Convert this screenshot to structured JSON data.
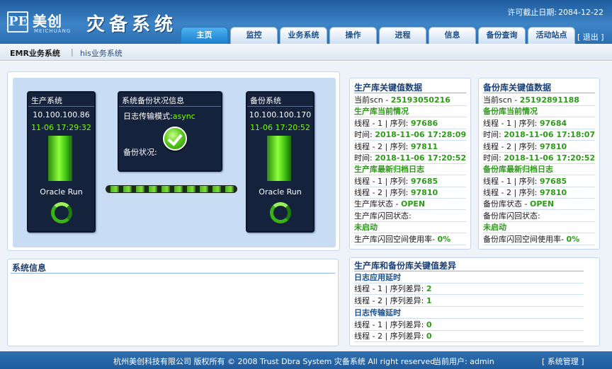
{
  "header": {
    "logo_mark": "PE",
    "logo_cn": "美创",
    "logo_en": "MEICHUANG",
    "app_title": "灾备系统",
    "license_label": "许可截止日期:",
    "license_date": "2084-12-22",
    "nav": [
      "主页",
      "监控",
      "业务系统",
      "操作",
      "进程",
      "信息",
      "备份查询",
      "活动站点"
    ],
    "logout": "[ 退出 ]"
  },
  "subnav": {
    "active": "EMR业务系统",
    "separator": "|",
    "other": "his业务系统"
  },
  "status": {
    "primary": {
      "title": "生产系统",
      "ip": "10.100.100.86",
      "time": "11-06 17:29:32",
      "run": "Oracle Run"
    },
    "middle": {
      "title": "系统备份状况信息",
      "mode_label": "日志传输模式:",
      "mode_value": "async",
      "state_label": "备份状况:"
    },
    "standby": {
      "title": "备份系统",
      "ip": "10.100.100.170",
      "time": "11-06 17:20:52",
      "run": "Oracle Run"
    }
  },
  "prod_panel": {
    "title": "生产库关键值数据",
    "scn_label": "当前scn - ",
    "scn_value": "25193050216",
    "current_title": "生产库当前情况",
    "t1_label": "线程 - 1 | 序列: ",
    "t1_seq": "97686",
    "t1_time_label": "时间: ",
    "t1_time": "2018-11-06 17:28:09",
    "t2_label": "线程 - 2 | 序列: ",
    "t2_seq": "97811",
    "t2_time_label": "时间: ",
    "t2_time": "2018-11-06 17:20:52",
    "archive_title": "生产库最新归档日志",
    "a1_label": "线程 - 1 | 序列: ",
    "a1_seq": "97685",
    "a2_label": "线程 - 2 | 序列: ",
    "a2_seq": "97810",
    "state_label": "生产库状态 - ",
    "state_value": "OPEN",
    "flash_label": "生产库闪回状态:",
    "flash_value": "未启动",
    "flash_use_label": "生产库闪回空间使用率- ",
    "flash_use_value": "0%"
  },
  "backup_panel": {
    "title": "备份库关键值数据",
    "scn_label": "当前scn - ",
    "scn_value": "25192891188",
    "current_title": "备份库当前情况",
    "t1_label": "线程 - 1 | 序列: ",
    "t1_seq": "97684",
    "t1_time_label": "时间: ",
    "t1_time": "2018-11-06 17:18:07",
    "t2_label": "线程 - 2 | 序列: ",
    "t2_seq": "97810",
    "t2_time_label": "时间: ",
    "t2_time": "2018-11-06 17:20:52",
    "archive_title": "备份库最新归档日志",
    "a1_label": "线程 - 1 | 序列: ",
    "a1_seq": "97685",
    "a2_label": "线程 - 2 | 序列: ",
    "a2_seq": "97810",
    "state_label": "备份库状态 - ",
    "state_value": "OPEN",
    "flash_label": "备份库闪回状态:",
    "flash_value": "未启动",
    "flash_use_label": "备份库闪回空间使用率- ",
    "flash_use_value": "0%"
  },
  "diff_panel": {
    "title": "生产库和备份库关键值差异",
    "apply_title": "日志应用延时",
    "ap1_label": "线程 - 1 | 序列差异: ",
    "ap1_value": "2",
    "ap2_label": "线程 - 2 | 序列差异: ",
    "ap2_value": "1",
    "transfer_title": "日志传输延时",
    "tr1_label": "线程 - 1 | 序列差异: ",
    "tr1_value": "0",
    "tr2_label": "线程 - 2 | 序列差异: ",
    "tr2_value": "0"
  },
  "sysinfo": {
    "title": "系统信息"
  },
  "footer": {
    "copyright": "杭州美创科技有限公司 版权所有 © 2008 Trust Dbra System 灾备系统 All right reserved.",
    "user_label": "当前用户: ",
    "user_value": "admin",
    "admin_link": "[ 系统管理 ]"
  },
  "colors": {
    "header_blue": "#2b6fb3",
    "active_tab": "#1b7fcf",
    "ok_green": "#2e9a1a",
    "status_green": "#78ff00",
    "panel_title": "#1c3f73"
  },
  "icons": [
    "check-ok-icon",
    "status-ring-icon"
  ]
}
